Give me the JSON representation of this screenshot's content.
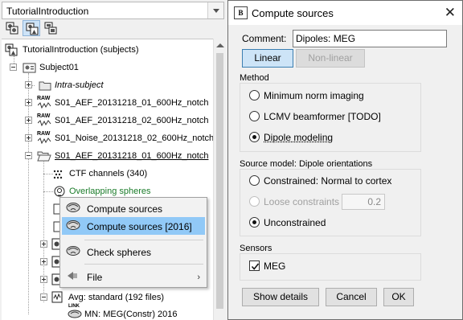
{
  "protocol_selector": {
    "value": "TutorialIntroduction"
  },
  "view_buttons": [
    {
      "icon": "functional-data-view-icon"
    },
    {
      "icon": "subject-view-icon"
    },
    {
      "icon": "study-view-icon"
    }
  ],
  "tree": {
    "root": "TutorialIntroduction (subjects)",
    "subject": "Subject01",
    "intra": "Intra-subject",
    "raw1": "S01_AEF_20131218_01_600Hz_notch",
    "raw2": "S01_AEF_20131218_02_600Hz_notch",
    "raw3": "S01_Noise_20131218_02_600Hz_notch",
    "folder": "S01_AEF_20131218_01_600Hz_notch",
    "channels": "CTF channels (340)",
    "headmodel": "Overlapping spheres",
    "avg": "Avg: standard (192 files)",
    "link": "MN: MEG(Constr) 2016",
    "raw_badge": "RAW",
    "link_badge": "LINK"
  },
  "context_menu": {
    "items": [
      {
        "label": "Compute sources",
        "icon": "brain-icon"
      },
      {
        "label": "Compute sources [2016]",
        "icon": "brain-icon"
      },
      {
        "label": "Check spheres",
        "icon": "brain-icon"
      },
      {
        "label": "File",
        "icon": "file-icon",
        "submenu": "›"
      }
    ],
    "highlighted_index": 1
  },
  "dialog": {
    "title": "Compute sources",
    "logo_text": "B",
    "close_symbol": "✕",
    "comment_label": "Comment:",
    "comment_value": "Dipoles: MEG",
    "mode_buttons": {
      "linear": "Linear",
      "nonlinear": "Non-linear"
    },
    "method": {
      "title": "Method",
      "options": [
        "Minimum norm imaging",
        "LCMV beamformer [TODO]",
        "Dipole modeling"
      ],
      "selected": 2
    },
    "source_model": {
      "title": "Source model: Dipole orientations",
      "constrained": "Constrained:  Normal to cortex",
      "loose": "Loose constraints",
      "loose_value": "0.2",
      "unconstrained": "Unconstrained",
      "selected": "unconstrained"
    },
    "sensors": {
      "title": "Sensors",
      "meg_label": "MEG",
      "meg_checked": true
    },
    "buttons": {
      "show_details": "Show details",
      "cancel": "Cancel",
      "ok": "OK"
    }
  }
}
